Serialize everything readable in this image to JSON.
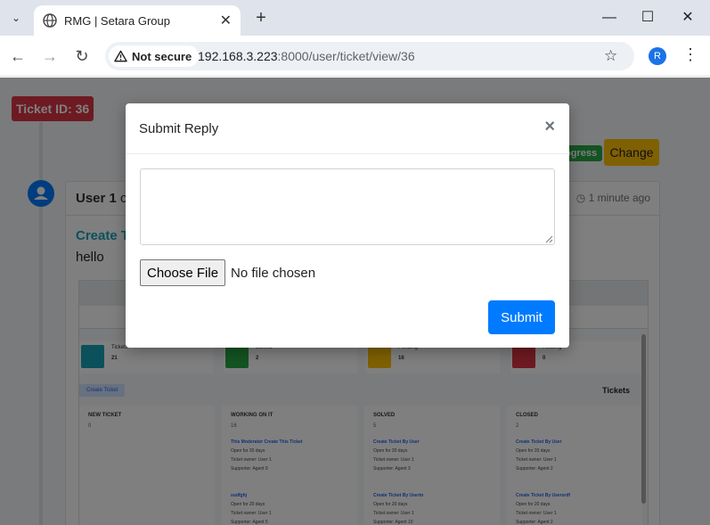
{
  "browser": {
    "tab_title": "RMG | Setara Group",
    "security_label": "Not secure",
    "url_host": "192.168.3.223",
    "url_path": ":8000/user/ticket/view/36",
    "profile_initial": "R"
  },
  "page": {
    "ticket_badge": "Ticket ID: 36",
    "status_badge": "ogress",
    "change_button": "Change",
    "reply": {
      "user": "User 1",
      "user_suffix": "cr",
      "time": "1 minute ago",
      "title": "Create T",
      "body": "hello"
    },
    "screenshot": {
      "stats": [
        {
          "label": "Tickets",
          "value": "21",
          "color": "#17a2b8"
        },
        {
          "label": "Solved",
          "value": "2",
          "color": "#28a745"
        },
        {
          "label": "Pending",
          "value": "16",
          "color": "#ffc107"
        },
        {
          "label": "Awating",
          "value": "0",
          "color": "#dc3545"
        }
      ],
      "create_ticket": "Create Ticket",
      "tickets_label": "Tickets",
      "columns": [
        {
          "head": "NEW TICKET",
          "count": "0",
          "lines": []
        },
        {
          "head": "WORKING ON IT",
          "count": "16",
          "lines": [
            "This Moderator Create This Ticket",
            "Open for 20 days",
            "Ticket owner: User 1",
            "Supporter: Agent 9",
            "sudfghj",
            "Open for 20 days",
            "Ticket owner: User 1",
            "Supporter: Agent 5"
          ]
        },
        {
          "head": "SOLVED",
          "count": "5",
          "lines": [
            "Create Ticket By User",
            "Open for 20 days",
            "Ticket owner: User 1",
            "Supporter: Agent 3",
            "Create Ticket By Userto",
            "Open for 20 days",
            "Ticket owner: User 1",
            "Supporter: Agent 10"
          ]
        },
        {
          "head": "CLOSED",
          "count": "2",
          "lines": [
            "Create Ticket By User",
            "Open for 20 days",
            "Ticket owner: User 1",
            "Supporter: Agent 2",
            "Create Ticket By Usersrdf",
            "Open for 20 days",
            "Ticket owner: User 1",
            "Supporter: Agent 2"
          ]
        }
      ]
    }
  },
  "modal": {
    "title": "Submit Reply",
    "textarea_value": "",
    "file_button": "Choose File",
    "file_status": "No file chosen",
    "submit_label": "Submit"
  }
}
